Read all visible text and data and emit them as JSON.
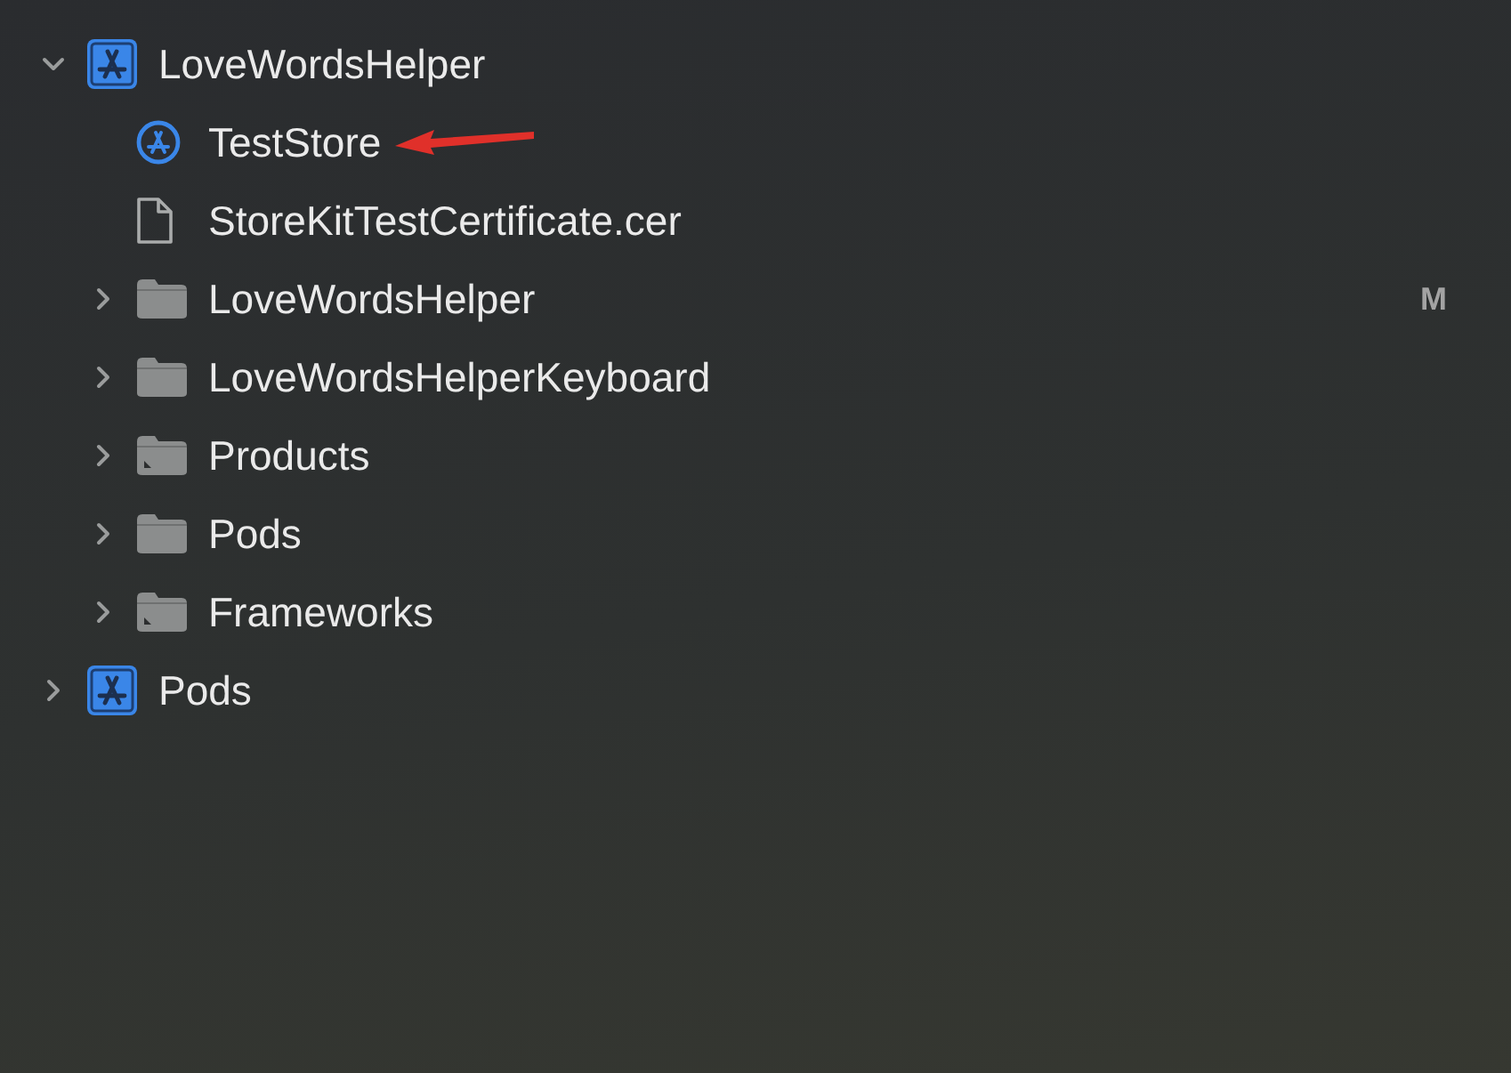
{
  "navigator": {
    "items": [
      {
        "kind": "project",
        "label": "LoveWordsHelper",
        "expanded": true,
        "children": [
          {
            "kind": "storekit",
            "label": "TestStore",
            "marked": true
          },
          {
            "kind": "file",
            "label": "StoreKitTestCertificate.cer"
          },
          {
            "kind": "folder",
            "label": "LoveWordsHelper",
            "expanded": false,
            "badge": "M"
          },
          {
            "kind": "folder",
            "label": "LoveWordsHelperKeyboard",
            "expanded": false
          },
          {
            "kind": "alias-folder",
            "label": "Products",
            "expanded": false
          },
          {
            "kind": "folder",
            "label": "Pods",
            "expanded": false
          },
          {
            "kind": "alias-folder",
            "label": "Frameworks",
            "expanded": false
          }
        ]
      },
      {
        "kind": "project",
        "label": "Pods",
        "expanded": false
      }
    ]
  }
}
